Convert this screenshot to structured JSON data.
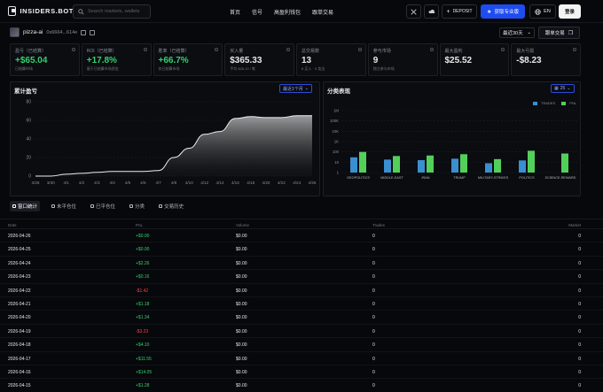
{
  "header": {
    "logo_text": "INSIDERS.BOT",
    "search_placeholder": "Search markets, wallets",
    "nav": [
      "首页",
      "信号",
      "高盈利钱包",
      "跟单交易"
    ],
    "deposit_label": "DEPOSIT",
    "pro_label": "获取专业版",
    "lang_label": "EN",
    "login_label": "登录"
  },
  "profile": {
    "name": "pizza-ai",
    "address": "0x6664...614e",
    "period_label": "最近30天",
    "copy_label": "跟单交易"
  },
  "stats": [
    {
      "label": "盈亏（已结算）",
      "value": "+$65.04",
      "sub": "已结算市场",
      "tone": "green"
    },
    {
      "label": "ROI（已结算）",
      "value": "+17.8%",
      "sub": "基于已结算市场资金",
      "tone": "green"
    },
    {
      "label": "胜率（已结算）",
      "value": "+66.7%",
      "sub": "仅已结算市场",
      "tone": "green"
    },
    {
      "label": "买入量",
      "value": "$365.33",
      "sub": "平均 $28.10 / 笔",
      "tone": "white"
    },
    {
      "label": "总交易数",
      "value": "13",
      "sub": "8 买入 · 5 卖出",
      "tone": "white"
    },
    {
      "label": "参与市场",
      "value": "9",
      "sub": "独立参与市场",
      "tone": "white"
    },
    {
      "label": "最大盈利",
      "value": "$25.52",
      "sub": "",
      "tone": "white"
    },
    {
      "label": "最大亏损",
      "value": "-$8.23",
      "sub": "",
      "tone": "white"
    }
  ],
  "cumulative_panel": {
    "title": "累计盈亏",
    "range_label": "最近1个月"
  },
  "category_panel": {
    "title": "分类表现",
    "count_label": "25",
    "legend_trades": "TRADES",
    "legend_pnl": "PNL"
  },
  "tabs": [
    "窗口统计",
    "未平仓位",
    "已平仓位",
    "分类",
    "交易历史"
  ],
  "table": {
    "headers": {
      "date": "Date",
      "pnl": "PnL",
      "volume": "Volume",
      "trades": "Trades",
      "markets": "Market"
    },
    "rows": [
      {
        "date": "2026-04-26",
        "pnl": "+$0.00",
        "tone": "green",
        "volume": "$0.00",
        "trades": "0",
        "markets": "0"
      },
      {
        "date": "2026-04-25",
        "pnl": "+$0.00",
        "tone": "green",
        "volume": "$0.00",
        "trades": "0",
        "markets": "0"
      },
      {
        "date": "2026-04-24",
        "pnl": "+$2.26",
        "tone": "green",
        "volume": "$0.00",
        "trades": "0",
        "markets": "0"
      },
      {
        "date": "2026-04-23",
        "pnl": "+$0.16",
        "tone": "green",
        "volume": "$0.00",
        "trades": "0",
        "markets": "0"
      },
      {
        "date": "2026-04-22",
        "pnl": "-$1.42",
        "tone": "red",
        "volume": "$0.00",
        "trades": "0",
        "markets": "0"
      },
      {
        "date": "2026-04-21",
        "pnl": "+$1.18",
        "tone": "green",
        "volume": "$0.00",
        "trades": "0",
        "markets": "0"
      },
      {
        "date": "2026-04-20",
        "pnl": "+$1.34",
        "tone": "green",
        "volume": "$0.00",
        "trades": "0",
        "markets": "0"
      },
      {
        "date": "2026-04-19",
        "pnl": "-$3.23",
        "tone": "red",
        "volume": "$0.00",
        "trades": "0",
        "markets": "0"
      },
      {
        "date": "2026-04-18",
        "pnl": "+$4.10",
        "tone": "green",
        "volume": "$0.00",
        "trades": "0",
        "markets": "0"
      },
      {
        "date": "2026-04-17",
        "pnl": "+$11.55",
        "tone": "green",
        "volume": "$0.00",
        "trades": "0",
        "markets": "0"
      },
      {
        "date": "2026-04-16",
        "pnl": "+$14.05",
        "tone": "green",
        "volume": "$0.00",
        "trades": "0",
        "markets": "0"
      },
      {
        "date": "2026-04-15",
        "pnl": "+$1.28",
        "tone": "green",
        "volume": "$0.00",
        "trades": "0",
        "markets": "0"
      }
    ]
  },
  "colors": {
    "green": "#34d06f",
    "red": "#f0484e",
    "accent": "#1f4cf0",
    "trades_bar": "#3a8fd0",
    "pnl_bar": "#52d05a"
  },
  "chart_data": [
    {
      "type": "area",
      "title": "累计盈亏",
      "x": [
        "3/28",
        "3/30",
        "4/1",
        "4/2",
        "4/3",
        "4/4",
        "4/5",
        "4/6",
        "4/7",
        "4/8",
        "4/10",
        "4/12",
        "4/14",
        "4/16",
        "4/18",
        "4/20",
        "4/22",
        "4/24",
        "4/26"
      ],
      "x_ticks": [
        "3/28",
        "3/30",
        "4/1",
        "4/2",
        "4/3",
        "4/4",
        "4/5",
        "4/6",
        "4/7",
        "4/8",
        "4/10",
        "4/12",
        "4/14",
        "4/16",
        "4/18",
        "4/20",
        "4/22",
        "4/24",
        "4/26"
      ],
      "values": [
        0,
        0,
        2,
        3,
        4,
        5,
        5,
        5,
        6,
        20,
        30,
        45,
        48,
        62,
        64,
        63,
        63,
        65,
        65
      ],
      "y_ticks": [
        0,
        20,
        40,
        60,
        80
      ],
      "ylim": [
        0,
        80
      ]
    },
    {
      "type": "bar",
      "title": "分类表现",
      "categories": [
        "GEOPOLITICS",
        "MIDDLE-EAST",
        "IRAN",
        "TRUMP",
        "MILITARY-STRIKES",
        "POLITICS",
        "SCIENCE-REWARD"
      ],
      "series": [
        {
          "name": "TRADES",
          "values": [
            30,
            18,
            16,
            22,
            8,
            15,
            0
          ]
        },
        {
          "name": "PNL",
          "values": [
            100,
            40,
            45,
            60,
            20,
            130,
            70
          ]
        }
      ],
      "y_ticks": [
        "1",
        "10",
        "100",
        "1K",
        "10K",
        "100K",
        "1M"
      ],
      "scale": "log"
    }
  ]
}
